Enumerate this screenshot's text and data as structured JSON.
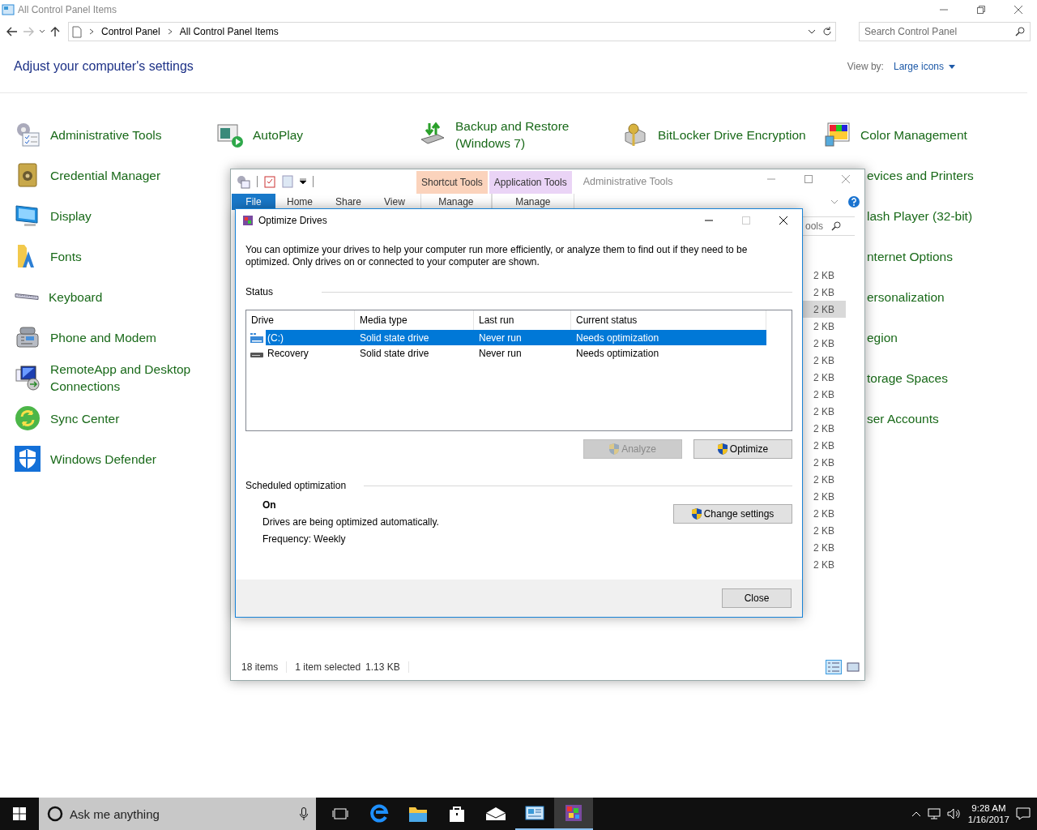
{
  "main_window": {
    "title": "All Control Panel Items",
    "breadcrumb": [
      "Control Panel",
      "All Control Panel Items"
    ],
    "search": {
      "placeholder": "Search Control Panel"
    },
    "heading": "Adjust your computer's settings",
    "view_by": {
      "label": "View by:",
      "value": "Large icons"
    },
    "columns": [
      [
        {
          "label": "Administrative Tools",
          "kind": "full"
        },
        {
          "label": "Credential Manager",
          "kind": "full"
        },
        {
          "label": "Display",
          "kind": "full"
        },
        {
          "label": "Fonts",
          "kind": "full"
        },
        {
          "label": "Keyboard",
          "kind": "full"
        },
        {
          "label": "Phone and Modem",
          "kind": "full"
        },
        {
          "label": "RemoteApp and Desktop Connections",
          "kind": "full"
        },
        {
          "label": "Sync Center",
          "kind": "full"
        },
        {
          "label": "Windows Defender",
          "kind": "full"
        }
      ],
      [
        {
          "label": "AutoPlay",
          "kind": "full"
        }
      ],
      [
        {
          "label": "Backup and Restore (Windows 7)",
          "kind": "full"
        }
      ],
      [
        {
          "label": "BitLocker Drive Encryption",
          "kind": "full"
        }
      ],
      [
        {
          "label": "Color Management",
          "kind": "full"
        },
        {
          "label": "evices and Printers",
          "kind": "partial"
        },
        {
          "label": "lash Player (32-bit)",
          "kind": "partial"
        },
        {
          "label": "nternet Options",
          "kind": "partial"
        },
        {
          "label": "ersonalization",
          "kind": "partial"
        },
        {
          "label": "egion",
          "kind": "partial"
        },
        {
          "label": "torage Spaces",
          "kind": "partial"
        },
        {
          "label": "ser Accounts",
          "kind": "partial"
        }
      ]
    ]
  },
  "explorer_window": {
    "title": "Administrative Tools",
    "context_tabs": [
      {
        "label": "Shortcut Tools",
        "tab": "Manage",
        "color": "#fbd3bc"
      },
      {
        "label": "Application Tools",
        "tab": "Manage",
        "color": "#ead4f6"
      }
    ],
    "ribbon_tabs": [
      {
        "label": "File",
        "kind": "file"
      },
      {
        "label": "Home",
        "kind": "tab"
      },
      {
        "label": "Share",
        "kind": "tab"
      },
      {
        "label": "View",
        "kind": "tab"
      }
    ],
    "search_fragment": "ools",
    "size_column": [
      {
        "text": "2 KB",
        "selected": false
      },
      {
        "text": "2 KB",
        "selected": false
      },
      {
        "text": "2 KB",
        "selected": true
      },
      {
        "text": "2 KB",
        "selected": false
      },
      {
        "text": "2 KB",
        "selected": false
      },
      {
        "text": "2 KB",
        "selected": false
      },
      {
        "text": "2 KB",
        "selected": false
      },
      {
        "text": "2 KB",
        "selected": false
      },
      {
        "text": "2 KB",
        "selected": false
      },
      {
        "text": "2 KB",
        "selected": false
      },
      {
        "text": "2 KB",
        "selected": false
      },
      {
        "text": "2 KB",
        "selected": false
      },
      {
        "text": "2 KB",
        "selected": false
      },
      {
        "text": "2 KB",
        "selected": false
      },
      {
        "text": "2 KB",
        "selected": false
      },
      {
        "text": "2 KB",
        "selected": false
      },
      {
        "text": "2 KB",
        "selected": false
      },
      {
        "text": "2 KB",
        "selected": false
      }
    ],
    "status_bar": {
      "items": "18 items",
      "selection": "1 item selected",
      "size": "1.13 KB"
    }
  },
  "dialog": {
    "title": "Optimize Drives",
    "description": "You can optimize your drives to help your computer run more efficiently, or analyze them to find out if they need to be optimized. Only drives on or connected to your computer are shown.",
    "status_label": "Status",
    "columns": [
      "Drive",
      "Media type",
      "Last run",
      "Current status"
    ],
    "drives": [
      {
        "drive": "(C:)",
        "media": "Solid state drive",
        "last_run": "Never run",
        "status": "Needs optimization",
        "kind": "system",
        "selected": true
      },
      {
        "drive": "Recovery",
        "media": "Solid state drive",
        "last_run": "Never run",
        "status": "Needs optimization",
        "kind": "plain",
        "selected": false
      }
    ],
    "buttons": [
      {
        "label": "Analyze",
        "disabled": true
      },
      {
        "label": "Optimize",
        "disabled": false
      }
    ],
    "schedule": {
      "label": "Scheduled optimization",
      "state": "On",
      "description": "Drives are being optimized automatically.",
      "frequency": "Frequency: Weekly",
      "button": "Change settings"
    },
    "close": "Close"
  },
  "taskbar": {
    "search_placeholder": "Ask me anything",
    "apps": [
      {
        "open": false,
        "selected": false
      },
      {
        "open": false,
        "selected": false
      },
      {
        "open": false,
        "selected": false
      },
      {
        "open": false,
        "selected": false
      },
      {
        "open": false,
        "selected": false
      },
      {
        "open": true,
        "selected": false
      },
      {
        "open": true,
        "selected": true
      }
    ],
    "time": "9:28 AM",
    "date": "1/16/2017"
  }
}
